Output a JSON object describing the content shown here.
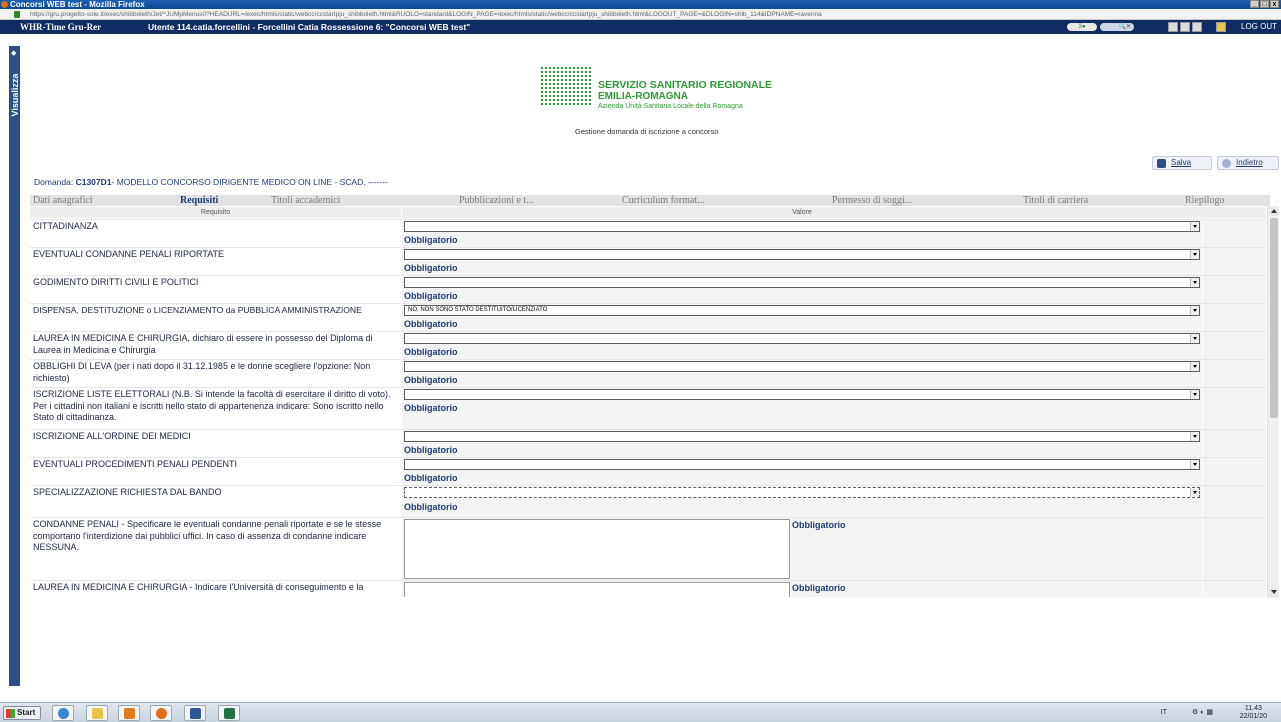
{
  "browser": {
    "title": "Concorsi WEB test - Mozilla Firefox",
    "url": "https://gru.progetto-sole.it/exec/shibboleth/Jet/^JUMpMenus0?HEADURL=/exec/htmls/static/webcc/ccstartpju_shibboleth.html&RUOLO=standard&LOGIN_PAGE=/exec/htmls/static/webcc/ccstartpju_shibboleth.html&LOGOUT_PAGE=&DLOGIN=shib_114&IDPNAME=ravenna"
  },
  "appbar": {
    "brand": "WHR-Time Gru-Rer",
    "user_info": "Utente 114.catia.forcellini - Forcellini Catia Rossessione 6: \"Concorsi WEB test\"",
    "counter": "3●",
    "logout": "LOG OUT"
  },
  "sidebar": {
    "label": "Visualizza"
  },
  "logo": {
    "line1": "SERVIZIO SANITARIO REGIONALE",
    "line2": "EMILIA-ROMAGNA",
    "line3": "Azienda Unità Sanitaria Locale della Romagna"
  },
  "subtitle": "Gestione domanda di iscrizione a concorso",
  "actions": {
    "save": "Salva",
    "back": "Indietro"
  },
  "domanda": {
    "prefix": "Domanda: ",
    "code": "C1307D1",
    "description": "- MODELLO CONCORSO DIRIGENTE MEDICO ON LINE - SCAD. -------"
  },
  "tabs": [
    {
      "label": "Dati anagrafici"
    },
    {
      "label": "Requisiti"
    },
    {
      "label": "Titoli accademici"
    },
    {
      "label": "Pubblicazioni e t..."
    },
    {
      "label": "Curriculum format..."
    },
    {
      "label": "Permesso di soggi..."
    },
    {
      "label": "Titoli di carriera"
    },
    {
      "label": "Riepilogo"
    }
  ],
  "grid": {
    "col_requisito": "Requisito",
    "col_valore": "Valore",
    "obbligatorio": "Obbligatorio",
    "rows": [
      {
        "label": "CITTADINANZA",
        "value": ""
      },
      {
        "label": "EVENTUALI CONDANNE PENALI RIPORTATE",
        "value": ""
      },
      {
        "label": "GODIMENTO DIRITTI CIVILI E POLITICI",
        "value": ""
      },
      {
        "label": "DISPENSA, DESTITUZIONE o LICENZIAMENTO da PUBBLICA AMMINISTRAZIONE",
        "value": "NO, NON SONO STATO DESTITUITO/LICENZIATO"
      },
      {
        "label": "LAUREA IN MEDICINA E CHIRURGIA, dichiaro di essere in possesso del Diploma di Laurea in Medicina e Chirurgia",
        "value": ""
      },
      {
        "label": "OBBLIGHI DI LEVA (per i nati dopo il 31.12.1985 e le donne scegliere l'opzione: Non richiesto)",
        "value": ""
      },
      {
        "label": "ISCRIZIONE LISTE ELETTORALI (N.B. Si intende la facoltà di esercitare il diritto di voto). Per i cittadini non italiani e iscritti nello stato di appartenenza indicare: Sono iscritto nello Stato di cittadinanza.",
        "value": ""
      },
      {
        "label": "ISCRIZIONE ALL'ORDINE DEI MEDICI",
        "value": ""
      },
      {
        "label": "EVENTUALI PROCEDIMENTI PENALI PENDENTI",
        "value": ""
      },
      {
        "label": "SPECIALIZZAZIONE RICHIESTA DAL BANDO",
        "value": ""
      },
      {
        "label": "CONDANNE PENALI - Specificare le eventuali condanne penali riportate e se le stesse comportano l'interdizione dai pubblici uffici. In caso di assenza di condanne indicare NESSUNA.",
        "value": ""
      },
      {
        "label": "LAUREA IN MEDICINA E CHIRURGIA - Indicare l'Università di conseguimento e la",
        "value": ""
      }
    ]
  },
  "taskbar": {
    "start": "Start",
    "lang": "IT",
    "time": "11.43",
    "date": "22/01/20"
  }
}
